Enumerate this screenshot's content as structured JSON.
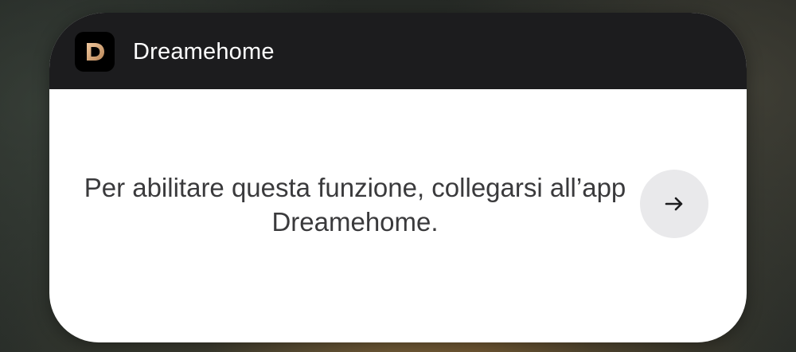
{
  "widget": {
    "app_name": "Dreamehome",
    "app_icon": {
      "name": "dreamehome-logo-icon",
      "letter": "D",
      "colors": {
        "background": "#000000",
        "letter": "#d9a97a"
      }
    },
    "message": "Per abilitare questa funzione, collegarsi all’app Dreamehome.",
    "action_button": {
      "icon": "arrow-right-icon"
    },
    "colors": {
      "header_background": "#1c1c1e",
      "body_background": "#ffffff",
      "button_background": "#e9e9eb",
      "text": "#3a3a3c"
    }
  }
}
